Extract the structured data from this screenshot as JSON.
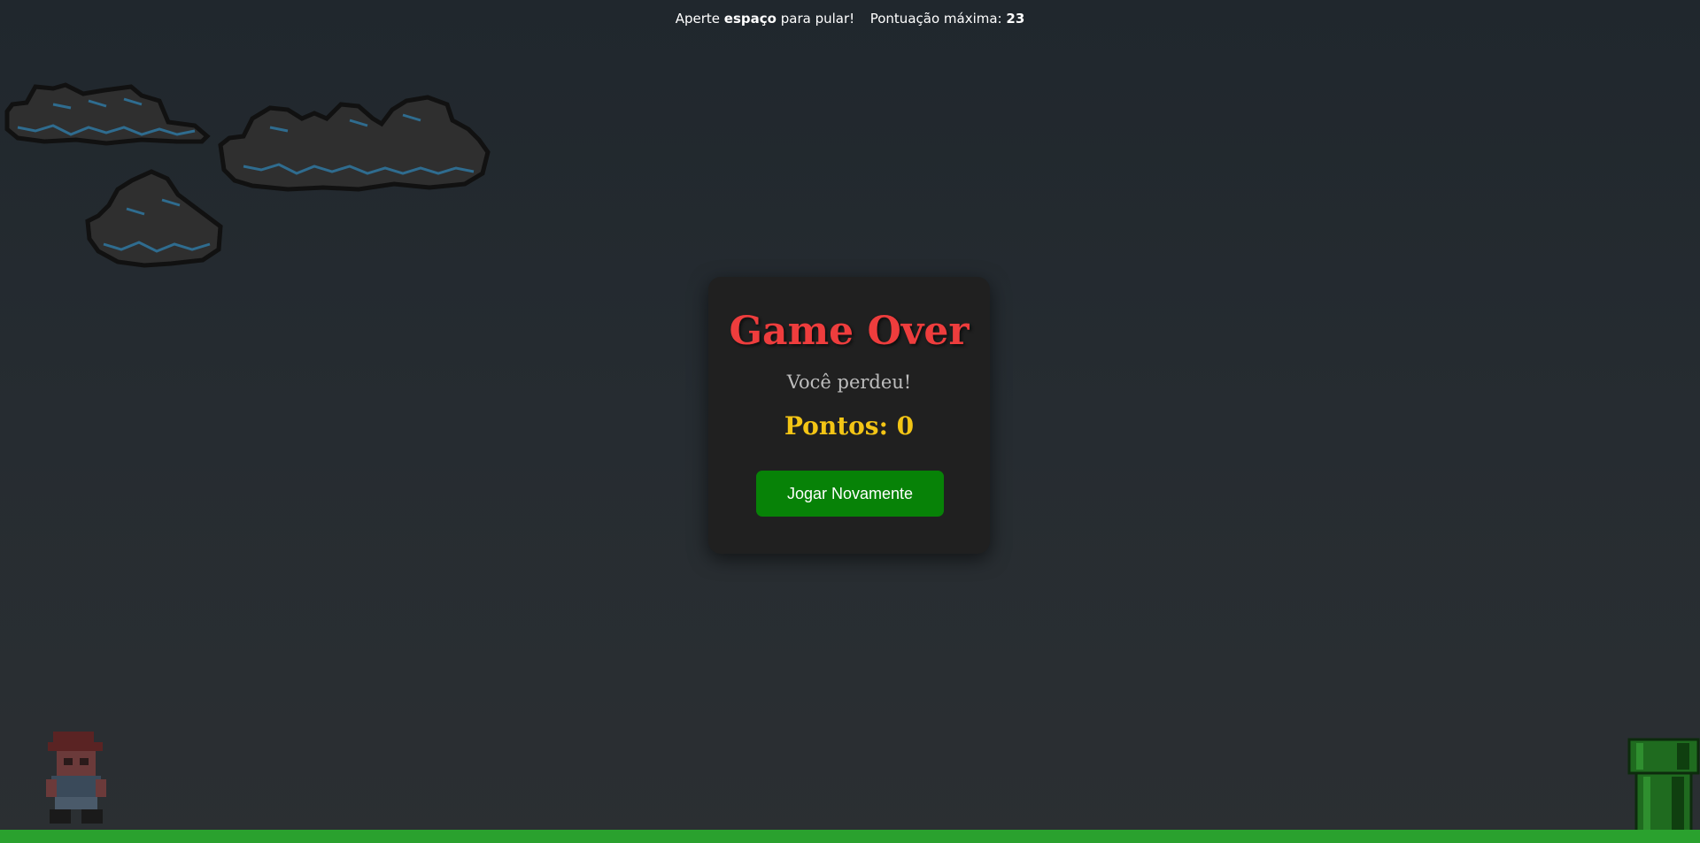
{
  "hud": {
    "prefix": "Aperte",
    "key": "espaço",
    "suffix": "para pular!",
    "highscore_label": "Pontuação máxima:",
    "highscore_value": "23"
  },
  "modal": {
    "title": "Game Over",
    "subtitle": "Você perdeu!",
    "score_label": "Pontos: 0",
    "button_label": "Jogar Novamente"
  },
  "colors": {
    "title": "#ee3d3d",
    "score": "#f3c515",
    "button": "#078207",
    "ground": "#2aa12e",
    "pipe": "#1f6b1f"
  },
  "sprites": {
    "player": "mario-icon",
    "obstacle": "pipe-icon",
    "clouds": "cloud-icon"
  }
}
